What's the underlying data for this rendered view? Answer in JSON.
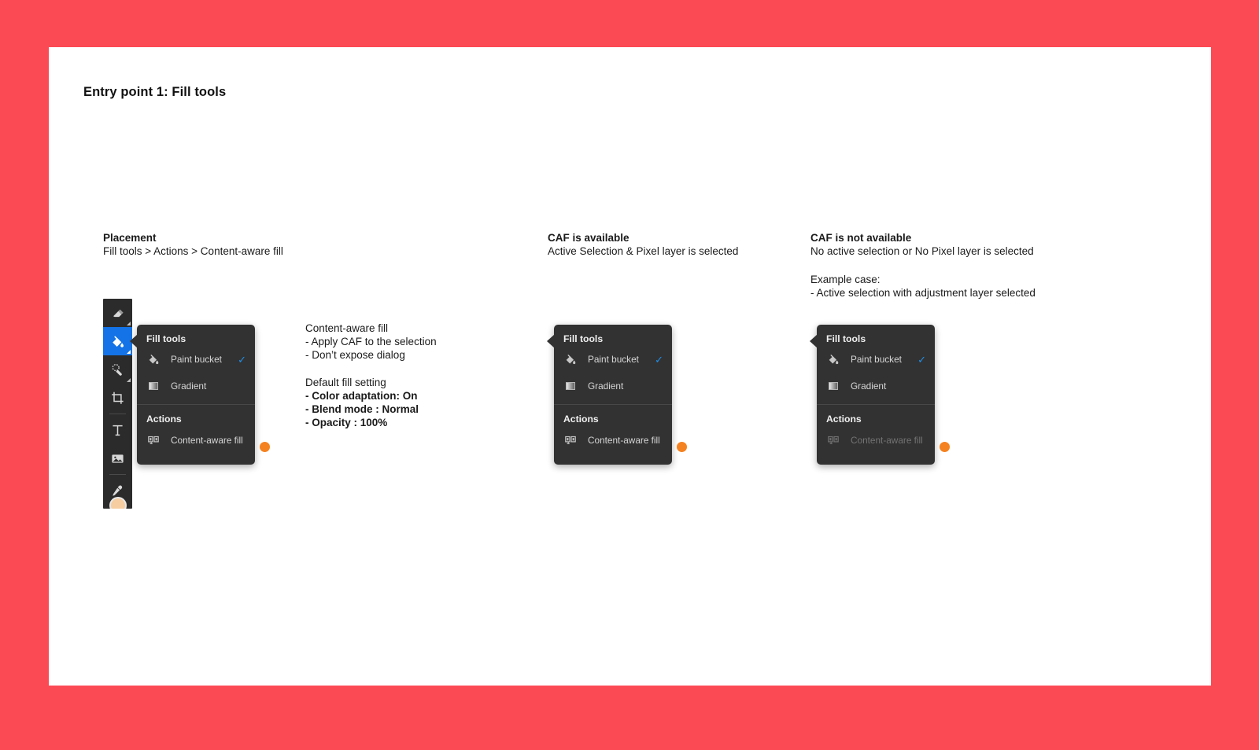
{
  "page": {
    "background_color": "#fc4a55",
    "card_color": "#ffffff",
    "title": "Entry point 1: Fill tools"
  },
  "annotations": {
    "placement": {
      "heading": "Placement",
      "path": "Fill tools > Actions > Content-aware fill"
    },
    "caf_available": {
      "heading": "CAF is available",
      "condition": "Active Selection & Pixel layer is selected"
    },
    "caf_not_available": {
      "heading": "CAF is not available",
      "condition": "No active selection or No Pixel layer is selected",
      "example_label": "Example case:",
      "example_value": "- Active selection with adjustment layer selected"
    }
  },
  "description": {
    "title": "Content-aware fill",
    "bullet_1": "- Apply CAF to the selection",
    "bullet_2": "- Don’t expose dialog",
    "settings_title": "Default fill setting",
    "setting_1": "- Color adaptation: On",
    "setting_2": "- Blend mode : Normal",
    "setting_3": "- Opacity : 100%"
  },
  "toolbar": {
    "background_color": "#2b2b2b",
    "active_color": "#1473e6",
    "tools": [
      {
        "name": "eraser-tool",
        "icon": "eraser-icon",
        "active": false,
        "has_flyout": true
      },
      {
        "name": "paint-bucket-tool",
        "icon": "paint-bucket-icon",
        "active": true,
        "has_flyout": true
      },
      {
        "name": "spot-healing-brush-tool",
        "icon": "spot-healing-brush-icon",
        "active": false,
        "has_flyout": true
      },
      {
        "name": "crop-tool",
        "icon": "crop-icon",
        "active": false,
        "has_flyout": false
      },
      {
        "name": "type-tool",
        "icon": "text-icon",
        "active": false,
        "has_flyout": false
      },
      {
        "name": "image-tool",
        "icon": "image-icon",
        "active": false,
        "has_flyout": false
      },
      {
        "name": "eyedropper-tool",
        "icon": "eyedropper-icon",
        "active": false,
        "has_flyout": false
      }
    ],
    "color_swatch": "#f5cda0"
  },
  "menus": [
    {
      "id": "menu-1",
      "fill_tools_title": "Fill tools",
      "actions_title": "Actions",
      "items": [
        {
          "label": "Paint bucket",
          "icon": "paint-bucket-icon",
          "checked": true,
          "disabled": false
        },
        {
          "label": "Gradient",
          "icon": "gradient-icon",
          "checked": false,
          "disabled": false
        }
      ],
      "actions": [
        {
          "label": "Content-aware fill",
          "icon": "content-aware-fill-icon",
          "disabled": false
        }
      ],
      "marker_color": "#f58220"
    },
    {
      "id": "menu-2",
      "fill_tools_title": "Fill tools",
      "actions_title": "Actions",
      "items": [
        {
          "label": "Paint bucket",
          "icon": "paint-bucket-icon",
          "checked": true,
          "disabled": false
        },
        {
          "label": "Gradient",
          "icon": "gradient-icon",
          "checked": false,
          "disabled": false
        }
      ],
      "actions": [
        {
          "label": "Content-aware fill",
          "icon": "content-aware-fill-icon",
          "disabled": false
        }
      ],
      "marker_color": "#f58220"
    },
    {
      "id": "menu-3",
      "fill_tools_title": "Fill tools",
      "actions_title": "Actions",
      "items": [
        {
          "label": "Paint bucket",
          "icon": "paint-bucket-icon",
          "checked": true,
          "disabled": false
        },
        {
          "label": "Gradient",
          "icon": "gradient-icon",
          "checked": false,
          "disabled": false
        }
      ],
      "actions": [
        {
          "label": "Content-aware fill",
          "icon": "content-aware-fill-icon",
          "disabled": true
        }
      ],
      "marker_color": "#f58220"
    }
  ],
  "check_glyph": "✓"
}
